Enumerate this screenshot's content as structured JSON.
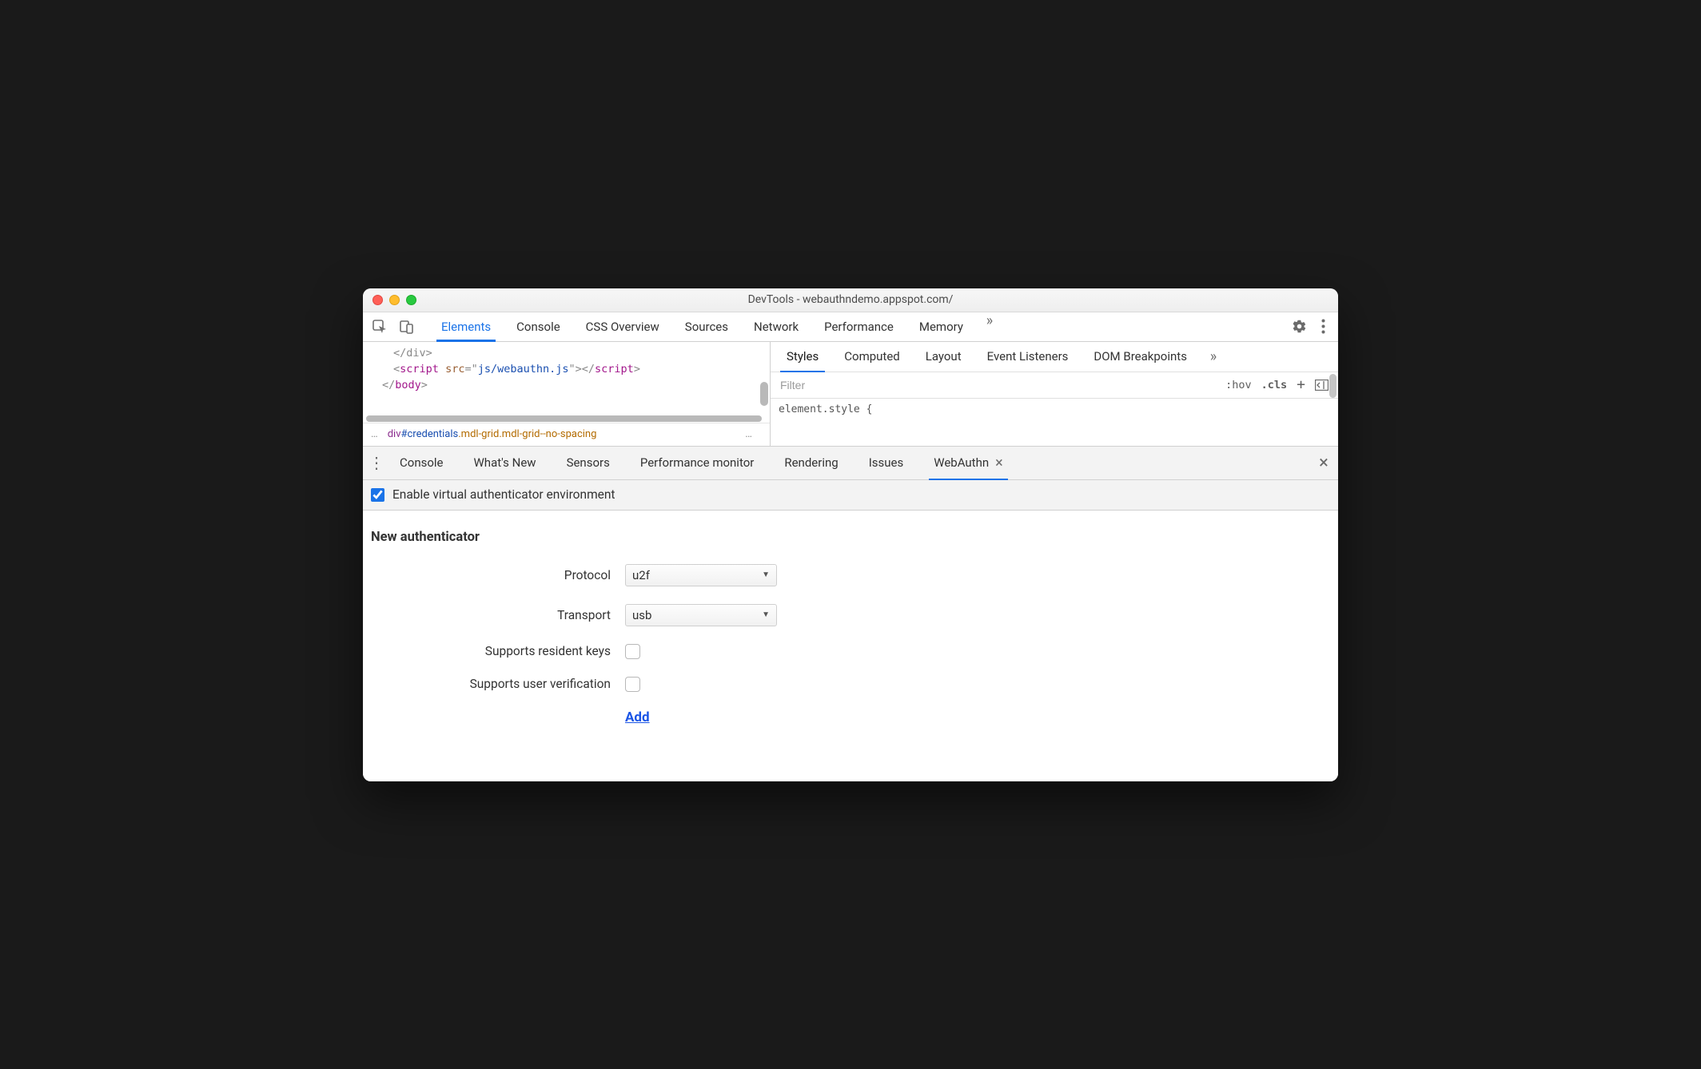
{
  "titlebar": {
    "title": "DevTools - webauthndemo.appspot.com/"
  },
  "mainTabs": {
    "items": [
      "Elements",
      "Console",
      "CSS Overview",
      "Sources",
      "Network",
      "Performance",
      "Memory"
    ],
    "activeIndex": 0,
    "moreGlyph": "»"
  },
  "code": {
    "line1": "</div>",
    "line2_open_tag": "<script",
    "line2_attr": "src",
    "line2_eq_q": "=\"",
    "line2_val": "js/webauthn.js",
    "line2_end_q": "\">",
    "line2_close_tag": "</script>",
    "line3": "</body>"
  },
  "breadcrumb": {
    "leading": "…",
    "element": "div",
    "id": "#credentials",
    "cls1": ".mdl-grid",
    "cls2": ".mdl-grid--no-spacing",
    "trailing": "…"
  },
  "sideTabs": {
    "items": [
      "Styles",
      "Computed",
      "Layout",
      "Event Listeners",
      "DOM Breakpoints"
    ],
    "activeIndex": 0,
    "moreGlyph": "»"
  },
  "filterRow": {
    "placeholder": "Filter",
    "hov": ":hov",
    "cls": ".cls",
    "plus": "+"
  },
  "stylesBody": {
    "text": "element.style {"
  },
  "drawerTabs": {
    "items": [
      "Console",
      "What's New",
      "Sensors",
      "Performance monitor",
      "Rendering",
      "Issues",
      "WebAuthn"
    ],
    "activeIndex": 6,
    "closeGlyph": "×"
  },
  "webauthn": {
    "enableLabel": "Enable virtual authenticator environment",
    "sectionTitle": "New authenticator",
    "rows": {
      "protocol": {
        "label": "Protocol",
        "value": "u2f"
      },
      "transport": {
        "label": "Transport",
        "value": "usb"
      },
      "resident": {
        "label": "Supports resident keys"
      },
      "userver": {
        "label": "Supports user verification"
      }
    },
    "addLabel": "Add"
  }
}
